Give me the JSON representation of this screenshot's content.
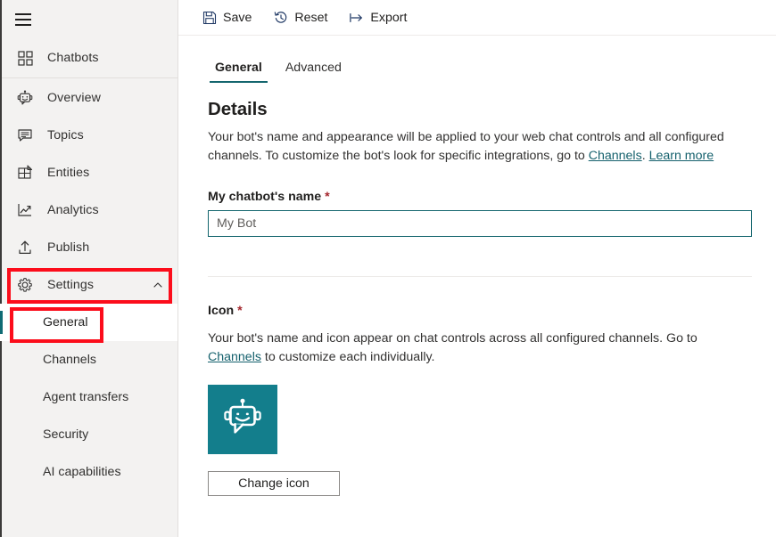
{
  "sidebar": {
    "menu_icon": "hamburger-icon",
    "top_item": {
      "label": "Chatbots",
      "icon": "grid-icon"
    },
    "items": [
      {
        "label": "Overview",
        "icon": "robot-icon"
      },
      {
        "label": "Topics",
        "icon": "chat-icon"
      },
      {
        "label": "Entities",
        "icon": "entities-icon"
      },
      {
        "label": "Analytics",
        "icon": "analytics-icon"
      },
      {
        "label": "Publish",
        "icon": "publish-icon"
      }
    ],
    "settings": {
      "label": "Settings",
      "icon": "gear-icon",
      "chevron": "chevron-up-icon",
      "expanded": true,
      "children": [
        {
          "label": "General",
          "selected": true
        },
        {
          "label": "Channels",
          "selected": false
        },
        {
          "label": "Agent transfers",
          "selected": false
        },
        {
          "label": "Security",
          "selected": false
        },
        {
          "label": "AI capabilities",
          "selected": false
        }
      ]
    }
  },
  "toolbar": {
    "save": {
      "label": "Save",
      "icon": "save-icon"
    },
    "reset": {
      "label": "Reset",
      "icon": "reset-clock-icon"
    },
    "export": {
      "label": "Export",
      "icon": "export-arrow-icon"
    }
  },
  "tabs": [
    {
      "label": "General",
      "active": true
    },
    {
      "label": "Advanced",
      "active": false
    }
  ],
  "details": {
    "heading": "Details",
    "description_part1": "Your bot's name and appearance will be applied to your web chat controls and all configured channels. To customize the bot's look for specific integrations, go to ",
    "channels_link": "Channels",
    "description_part2": ". ",
    "learn_more_link": "Learn more"
  },
  "name_field": {
    "label": "My chatbot's name",
    "required_marker": "*",
    "value": "My Bot",
    "placeholder": "My Bot"
  },
  "icon_section": {
    "label": "Icon",
    "required_marker": "*",
    "description_part1": "Your bot's name and icon appear on chat controls across all configured channels. Go to ",
    "channels_link": "Channels",
    "description_part2": " to customize each individually.",
    "tile_icon": "bot-avatar-icon",
    "change_button": "Change icon"
  },
  "colors": {
    "accent_teal": "#137e8c",
    "tab_underline": "#14666e",
    "input_border": "#14666e",
    "selection_bar": "#106b74",
    "link": "#15616d",
    "required_asterisk": "#a4262c",
    "sidebar_bg": "#f3f2f1",
    "annotation_red": "#fc0d1b"
  },
  "annotations": [
    {
      "name": "settings-highlight",
      "target": "Settings"
    },
    {
      "name": "general-highlight",
      "target": "General"
    }
  ]
}
